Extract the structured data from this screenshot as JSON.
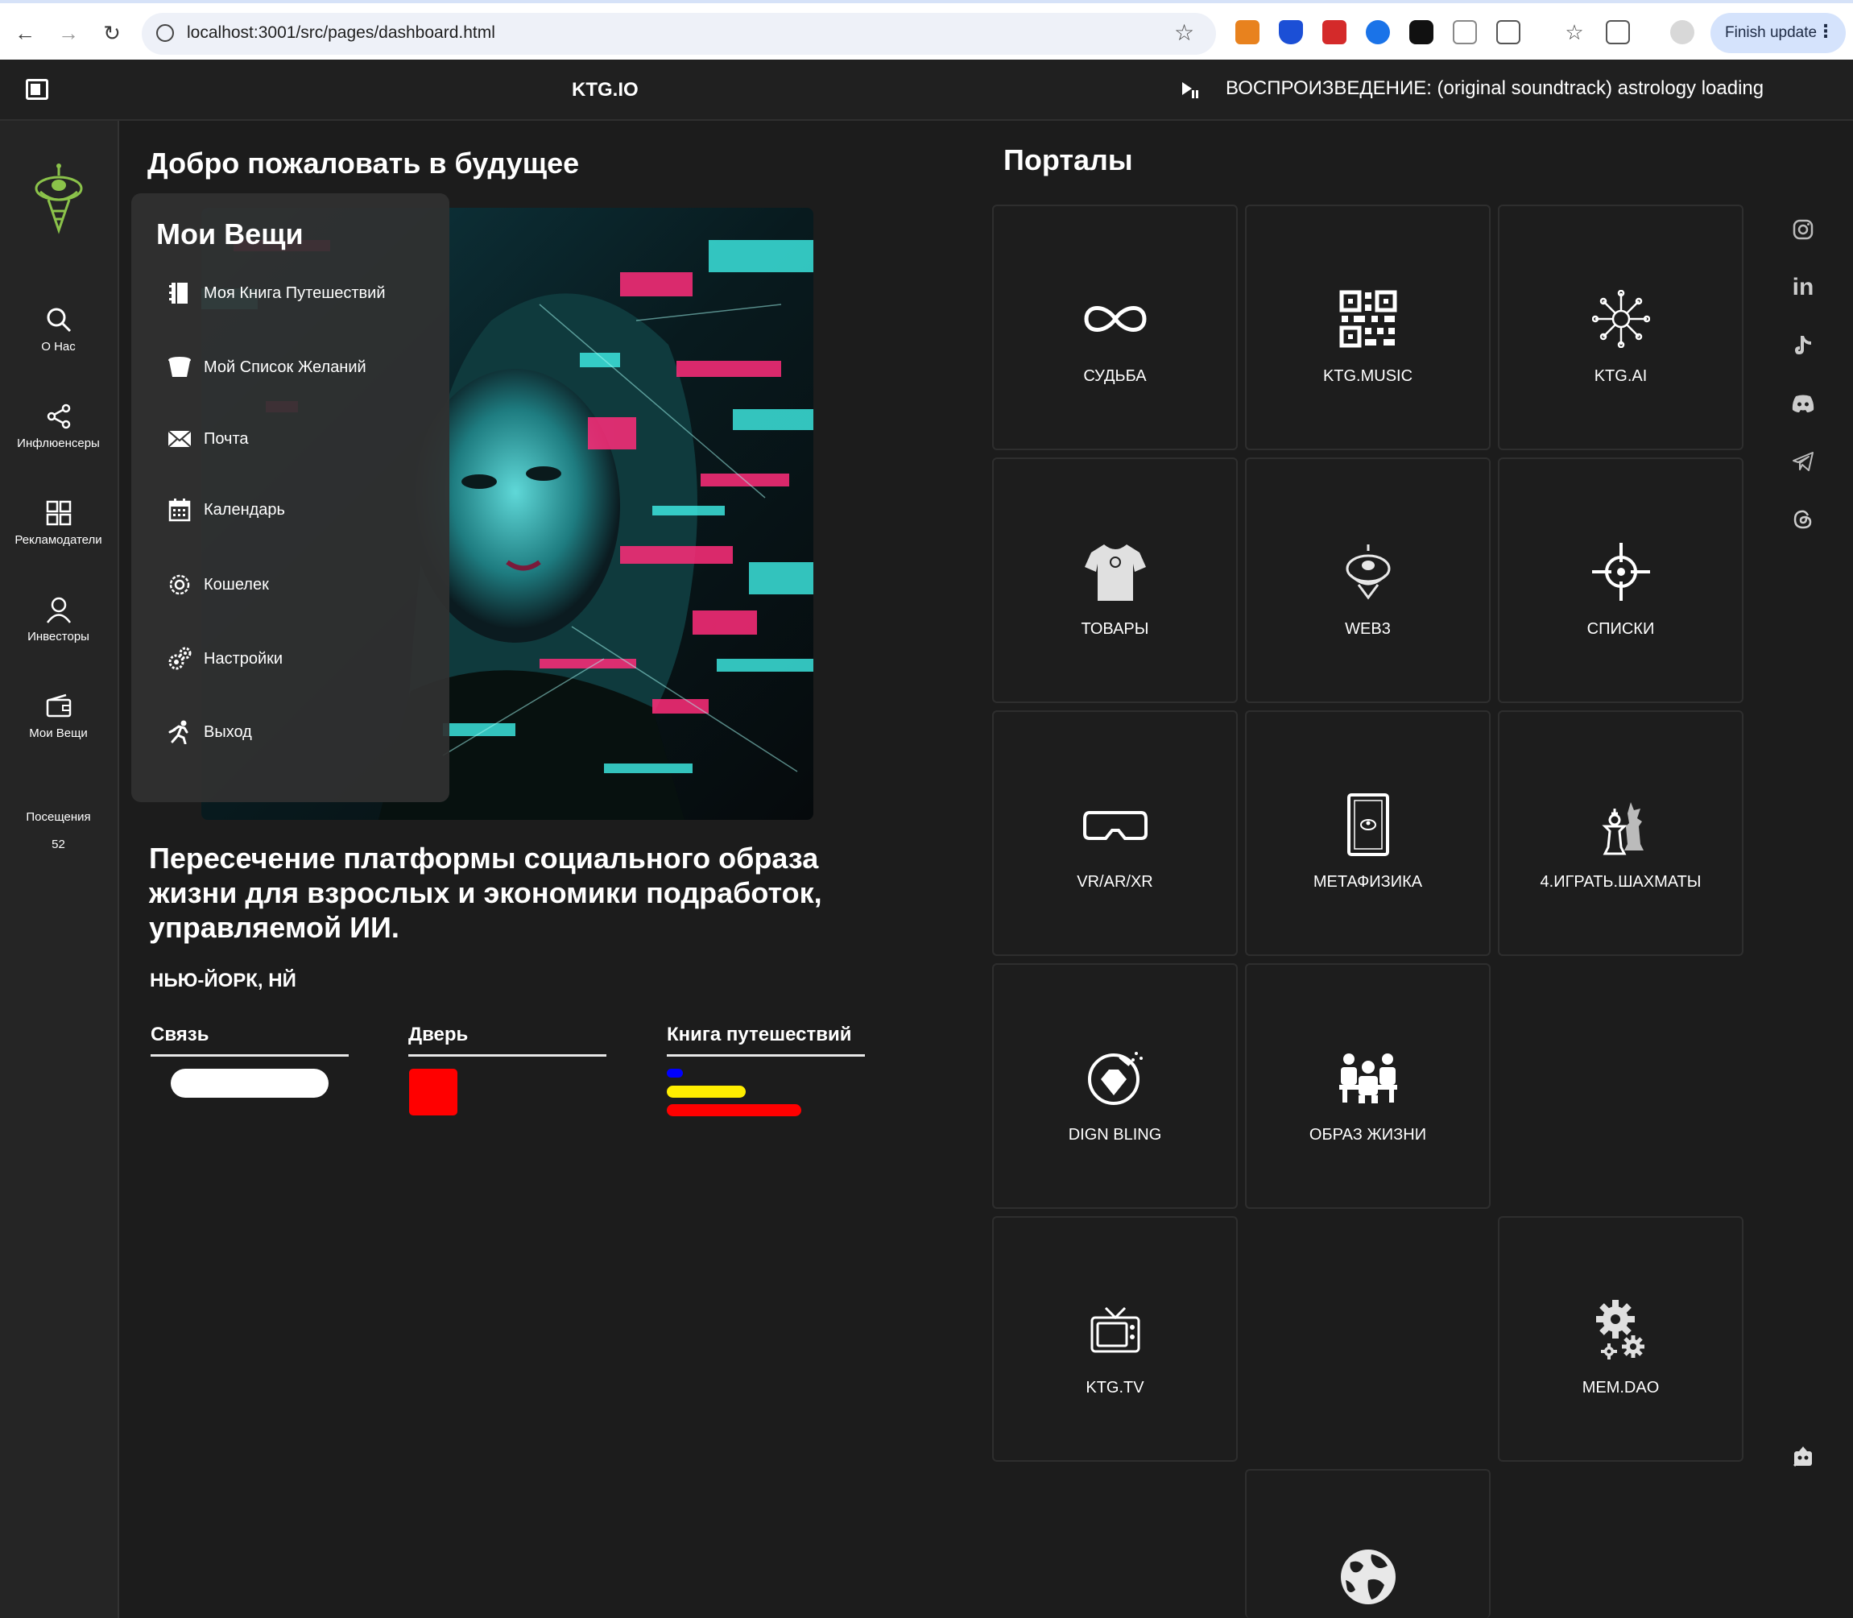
{
  "browser": {
    "url": "localhost:3001/src/pages/dashboard.html",
    "finish_update": "Finish update"
  },
  "topbar": {
    "brand": "KTG.IO",
    "now_playing": "ВОСПРОИЗВЕДЕНИЕ: (original soundtrack) astrology loading"
  },
  "sidebar": {
    "items": [
      {
        "label": "О Нас",
        "icon": "search-icon"
      },
      {
        "label": "Инфлюенсеры",
        "icon": "share-icon"
      },
      {
        "label": "Рекламодатели",
        "icon": "grid-icon"
      },
      {
        "label": "Инвесторы",
        "icon": "user-icon"
      },
      {
        "label": "Мои Вещи",
        "icon": "wallet-icon"
      }
    ],
    "visits_label": "Посещения",
    "visits_count": "52"
  },
  "main": {
    "title": "Добро пожаловать в будущее",
    "tagline": "Пересечение платформы социального образа жизни для взрослых и экономики подработок, управляемой ИИ.",
    "location": "НЬЮ-ЙОРК, НЙ",
    "stats": [
      {
        "label": "Связь"
      },
      {
        "label": "Дверь"
      },
      {
        "label": "Книга путешествий"
      }
    ]
  },
  "my_things": {
    "title": "Мои Вещи",
    "items": [
      {
        "label": "Моя Книга Путешествий",
        "icon": "book-icon"
      },
      {
        "label": "Мой Список Желаний",
        "icon": "cup-icon"
      },
      {
        "label": "Почта",
        "icon": "mail-icon"
      },
      {
        "label": "Календарь",
        "icon": "calendar-icon"
      },
      {
        "label": "Кошелек",
        "icon": "wallet-gear-icon"
      },
      {
        "label": "Настройки",
        "icon": "gears-icon"
      },
      {
        "label": "Выход",
        "icon": "running-icon"
      }
    ]
  },
  "portals": {
    "title": "Порталы",
    "tiles": [
      {
        "label": "СУДЬБА",
        "icon": "infinity-icon"
      },
      {
        "label": "KTG.MUSIC",
        "icon": "qr-icon"
      },
      {
        "label": "KTG.AI",
        "icon": "circuit-icon"
      },
      {
        "label": "ТОВАРЫ",
        "icon": "tshirt-icon"
      },
      {
        "label": "WEB3",
        "icon": "alien-ship-icon"
      },
      {
        "label": "СПИСКИ",
        "icon": "crosshair-icon"
      },
      {
        "label": "VR/AR/XR",
        "icon": "vr-headset-icon"
      },
      {
        "label": "МЕТАФИЗИКА",
        "icon": "tarot-card-icon"
      },
      {
        "label": "4.ИГРАТЬ.ШАХМАТЫ",
        "icon": "chess-icon"
      },
      {
        "label": "DIGN BLING",
        "icon": "diamond-icon"
      },
      {
        "label": "ОБРАЗ ЖИЗНИ",
        "icon": "people-icon"
      },
      {
        "label": "KTG.TV",
        "icon": "tv-icon"
      },
      {
        "label": "MEM.DAO",
        "icon": "gears-icon"
      },
      {
        "label": "",
        "icon": "globe-icon"
      }
    ]
  },
  "social": [
    "instagram-icon",
    "linkedin-icon",
    "tiktok-icon",
    "discord-icon",
    "telegram-icon",
    "threads-icon"
  ],
  "colors": {
    "accent_green": "#8bc34a",
    "red": "#ff0000",
    "yellow": "#ffee00",
    "blue": "#0000ff"
  }
}
